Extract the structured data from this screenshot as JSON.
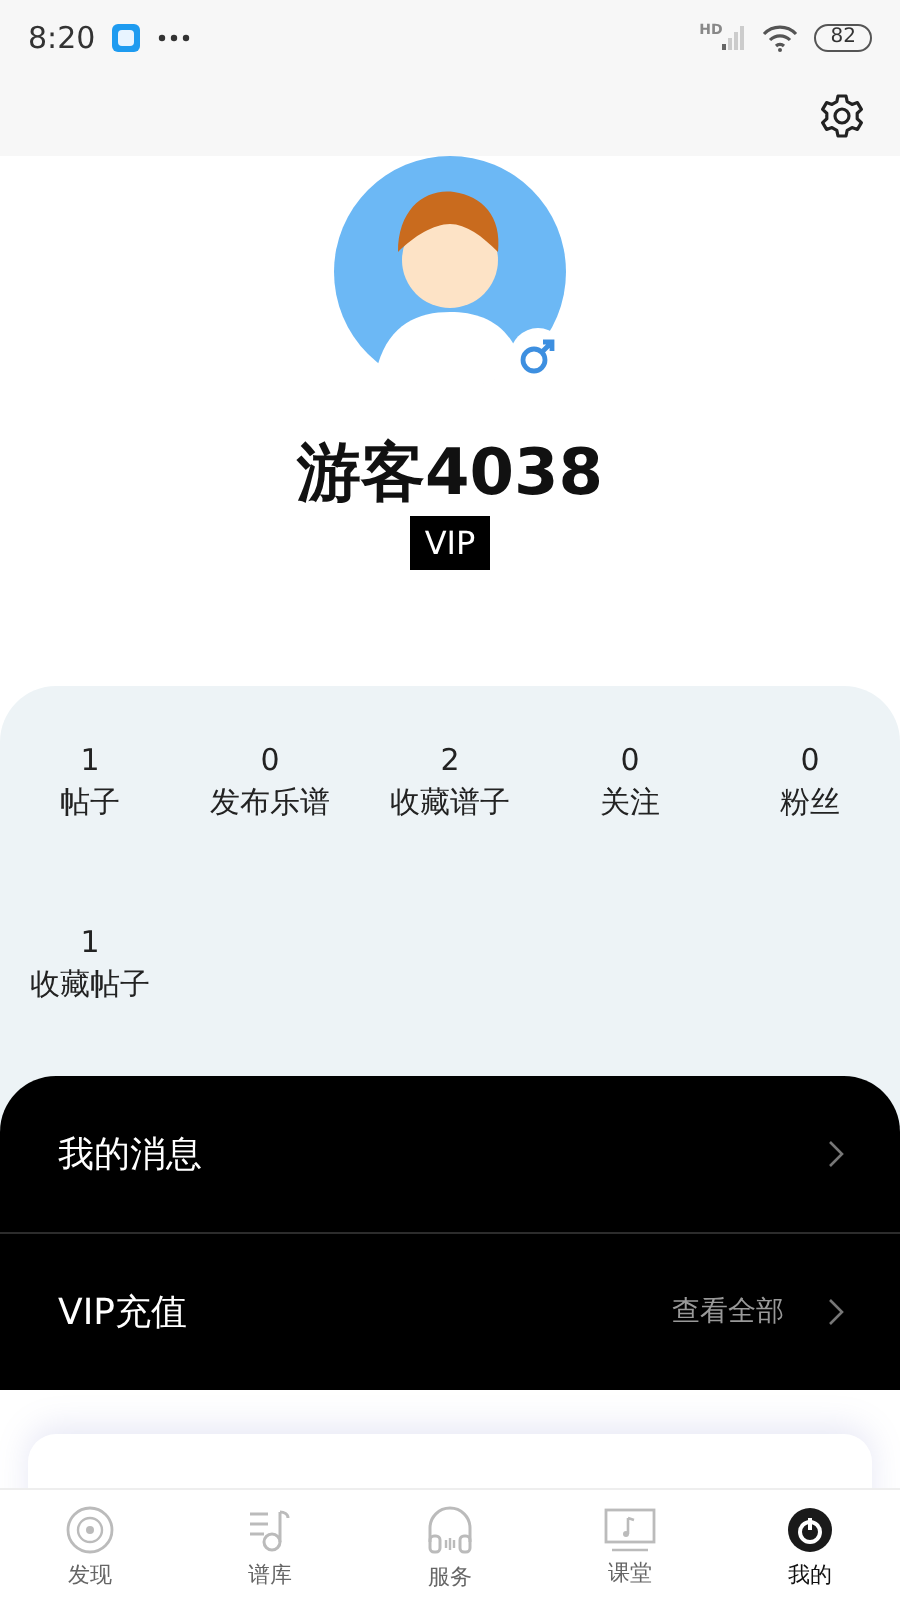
{
  "status_bar": {
    "time": "8:20",
    "network": "HD",
    "battery": "82"
  },
  "profile": {
    "name": "游客4038",
    "badge": "VIP",
    "gender_icon": {
      "kind": "male"
    }
  },
  "stats": [
    {
      "count": "1",
      "label": "帖子"
    },
    {
      "count": "0",
      "label": "发布乐谱"
    },
    {
      "count": "2",
      "label": "收藏谱子"
    },
    {
      "count": "0",
      "label": "关注"
    },
    {
      "count": "0",
      "label": "粉丝"
    },
    {
      "count": "1",
      "label": "收藏帖子"
    }
  ],
  "menu": [
    {
      "title": "我的消息"
    },
    {
      "title": "VIP充值",
      "value": "查看全部"
    }
  ],
  "tabs": [
    {
      "label": "发现",
      "kind": "disc",
      "selected": false
    },
    {
      "label": "谱库",
      "kind": "score",
      "selected": false
    },
    {
      "label": "服务",
      "kind": "headphones",
      "selected": false
    },
    {
      "label": "课堂",
      "kind": "screen",
      "selected": false
    },
    {
      "label": "我的",
      "kind": "me",
      "selected": true
    }
  ]
}
